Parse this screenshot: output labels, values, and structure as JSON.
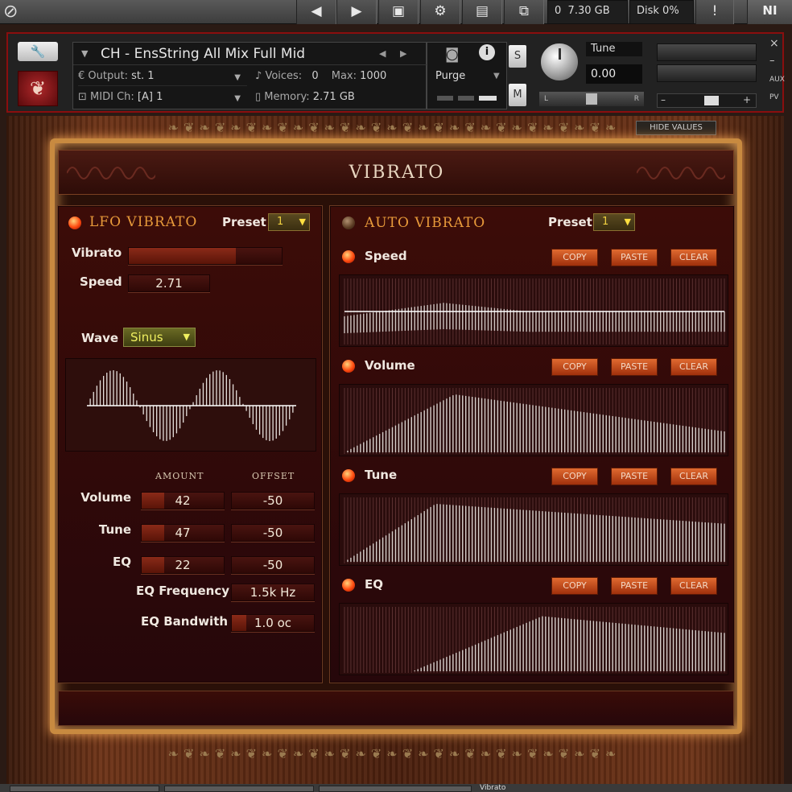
{
  "toolbar": {
    "memory": "7.30 GB",
    "disk": "Disk  0%",
    "ni": "NI",
    "memory_icon": "0"
  },
  "header": {
    "instrument_name": "CH - EnsString All Mix Full Mid",
    "output_label": "Output:",
    "output_value": "st. 1",
    "voices_label": "Voices:",
    "voices_value": "0",
    "max_label": "Max:",
    "max_value": "1000",
    "purge_label": "Purge",
    "midi_label": "MIDI Ch:",
    "midi_value": "[A]  1",
    "memory_label": "Memory:",
    "memory_value": "2.71 GB",
    "solo": "S",
    "mute": "M",
    "tune_label": "Tune",
    "tune_value": "0.00",
    "pan_left": "L",
    "pan_right": "R",
    "aux": "AUX",
    "pv": "PV",
    "close": "×",
    "minus": "–",
    "hide_values": "HIDE VALUES"
  },
  "title": "VIBRATO",
  "lfo": {
    "title": "LFO VIBRATO",
    "preset_label": "Preset",
    "preset_value": "1",
    "vibrato_label": "Vibrato",
    "vibrato_level": 0.7,
    "speed_label": "Speed",
    "speed_value": "2.71",
    "wave_label": "Wave",
    "wave_value": "Sinus",
    "amount_header": "AMOUNT",
    "offset_header": "OFFSET",
    "rows": [
      {
        "label": "Volume",
        "amount": "42",
        "offset": "-50"
      },
      {
        "label": "Tune",
        "amount": "47",
        "offset": "-50"
      },
      {
        "label": "EQ",
        "amount": "22",
        "offset": "-50"
      }
    ],
    "eq_freq_label": "EQ Frequency",
    "eq_freq_value": "1.5k Hz",
    "eq_bw_label": "EQ Bandwith",
    "eq_bw_value": "1.0 oc"
  },
  "auto": {
    "title": "AUTO VIBRATO",
    "preset_label": "Preset",
    "preset_value": "1",
    "copy": "COPY",
    "paste": "PASTE",
    "clear": "CLEAR",
    "sections": [
      {
        "label": "Speed"
      },
      {
        "label": "Volume"
      },
      {
        "label": "Tune"
      },
      {
        "label": "EQ"
      }
    ]
  },
  "status": {
    "tab_name": "Vibrato"
  }
}
